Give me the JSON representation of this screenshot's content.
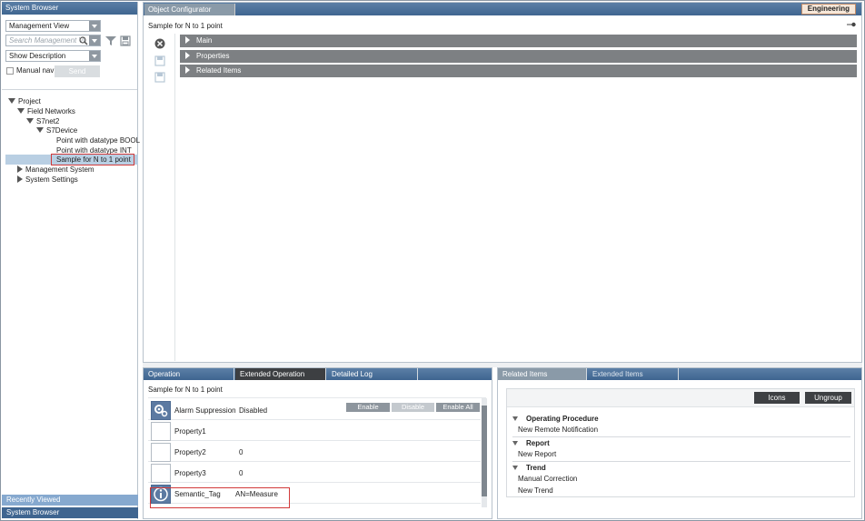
{
  "system_browser": {
    "title": "System Browser",
    "view_select": "Management View",
    "search_placeholder": "Search Management Vi",
    "description_select": "Show Description",
    "manual_nav_label": "Manual nav",
    "send_label": "Send",
    "tree": [
      {
        "label": "Project",
        "expanded": true
      },
      {
        "label": "Field Networks",
        "expanded": true
      },
      {
        "label": "S7net2",
        "expanded": true
      },
      {
        "label": "S7Device",
        "expanded": true
      },
      {
        "label": "Point with datatype BOOL"
      },
      {
        "label": "Point with datatype INT"
      },
      {
        "label": "Sample for N to 1 point",
        "selected": true
      },
      {
        "label": "Management System",
        "expanded": false
      },
      {
        "label": "System Settings",
        "expanded": false
      }
    ],
    "recently_viewed": "Recently Viewed",
    "system_browser_tab": "System Browser"
  },
  "object_configurator": {
    "tab": "Object Configurator",
    "mode": "Engineering",
    "title": "Sample for N to 1 point",
    "sections": [
      "Main",
      "Properties",
      "Related Items"
    ]
  },
  "operation_panel": {
    "tabs": [
      "Operation",
      "Extended Operation",
      "Detailed Log"
    ],
    "active_tab": "Extended Operation",
    "title": "Sample for N to 1 point",
    "buttons": {
      "enable": "Enable",
      "disable": "Disable",
      "enable_all": "Enable All"
    },
    "rows": [
      {
        "name": "Alarm Suppression",
        "value": "Disabled",
        "icon": "gears-icon"
      },
      {
        "name": "Property1",
        "value": ""
      },
      {
        "name": "Property2",
        "value": "0"
      },
      {
        "name": "Property3",
        "value": "0"
      },
      {
        "name": "Semantic_Tag",
        "value": "AN=Measure",
        "icon": "info-icon"
      }
    ]
  },
  "related_items": {
    "tabs": [
      "Related Items",
      "Extended Items"
    ],
    "icons_button": "Icons",
    "ungroup_button": "Ungroup",
    "groups": [
      {
        "name": "Operating Procedure",
        "items": [
          "New Remote Notification"
        ]
      },
      {
        "name": "Report",
        "items": [
          "New Report"
        ]
      },
      {
        "name": "Trend",
        "items": [
          "Manual Correction",
          "New Trend"
        ]
      }
    ]
  },
  "colors": {
    "header_blue": "#4a6f98",
    "selection": "#b9cfe3",
    "highlight_red": "#d23a3a",
    "section_gray": "#7d8083"
  }
}
